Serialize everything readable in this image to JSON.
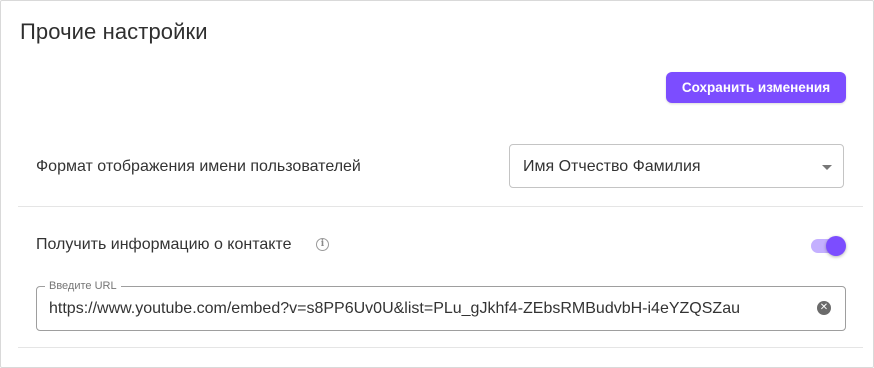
{
  "page": {
    "title": "Прочие настройки"
  },
  "toolbar": {
    "save_label": "Сохранить изменения"
  },
  "settings": {
    "name_format": {
      "label": "Формат отображения имени пользователей",
      "selected": "Имя Отчество Фамилия"
    },
    "contact_info": {
      "label": "Получить информацию о контакте",
      "info_icon": "info-icon",
      "enabled": true,
      "url_field": {
        "legend": "Введите URL",
        "value": "https://www.youtube.com/embed?v=s8PP6Uv0U&list=PLu_gJkhf4-ZEbsRMBudvbH-i4eYZQSZau",
        "clear_icon": "clear-icon"
      }
    }
  },
  "colors": {
    "accent": "#7c4dff",
    "accent_light": "#c4b0ff",
    "text": "#333333",
    "border": "#c4c4c4"
  }
}
